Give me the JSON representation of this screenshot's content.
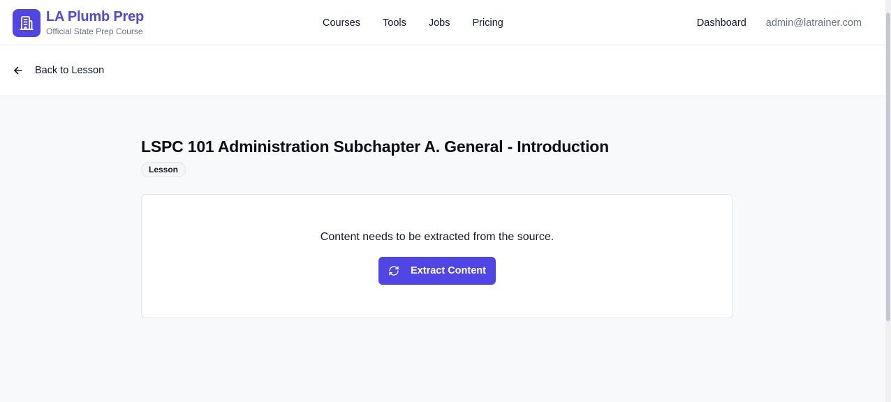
{
  "brand": {
    "title": "LA Plumb Prep",
    "subtitle": "Official State Prep Course",
    "logo_icon": "building-icon",
    "accent_color": "#4f46e5"
  },
  "nav": {
    "items": [
      {
        "label": "Courses"
      },
      {
        "label": "Tools"
      },
      {
        "label": "Jobs"
      },
      {
        "label": "Pricing"
      }
    ],
    "dashboard_label": "Dashboard",
    "user_email": "admin@latrainer.com"
  },
  "back": {
    "icon": "arrow-left-icon",
    "label": "Back to Lesson"
  },
  "lesson": {
    "title": "LSPC 101 Administration Subchapter A. General - Introduction",
    "badge": "Lesson"
  },
  "extract": {
    "message": "Content needs to be extracted from the source.",
    "button_label": "Extract Content",
    "button_icon": "refresh-icon"
  }
}
